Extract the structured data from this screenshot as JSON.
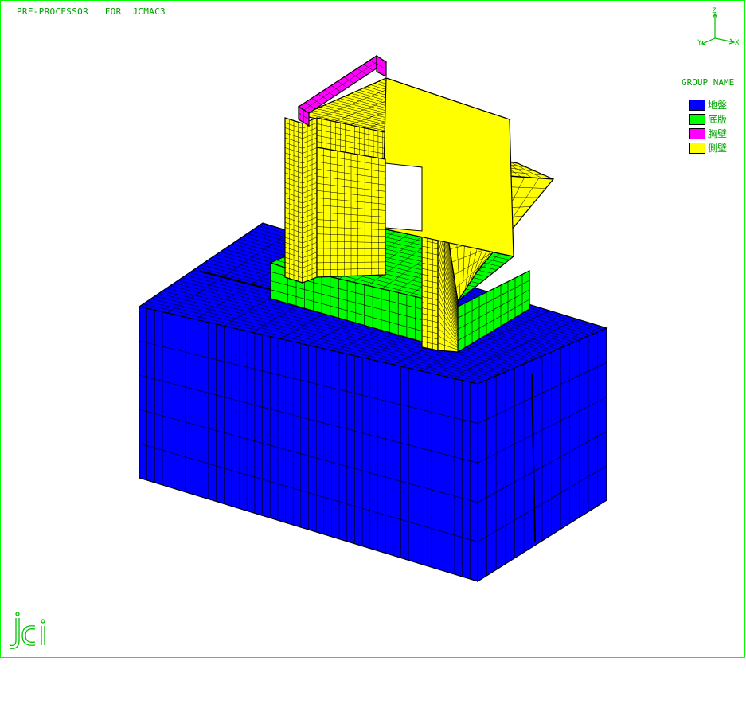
{
  "window": {
    "title": "PRE-PROCESSOR   FOR  JCMAC3"
  },
  "axes": {
    "z": "Z",
    "y": "Y",
    "x": "X"
  },
  "legend": {
    "title": "GROUP NAME",
    "items": [
      {
        "label": "地盤",
        "color": "#0000ff"
      },
      {
        "label": "底版",
        "color": "#00ff00"
      },
      {
        "label": "胸壁",
        "color": "#ff00ff"
      },
      {
        "label": "側壁",
        "color": "#ffff00"
      }
    ]
  },
  "logo": {
    "text": "jci"
  },
  "colors": {
    "frame": "#00ff00",
    "label": "#00a000",
    "mesh": "#000000"
  }
}
